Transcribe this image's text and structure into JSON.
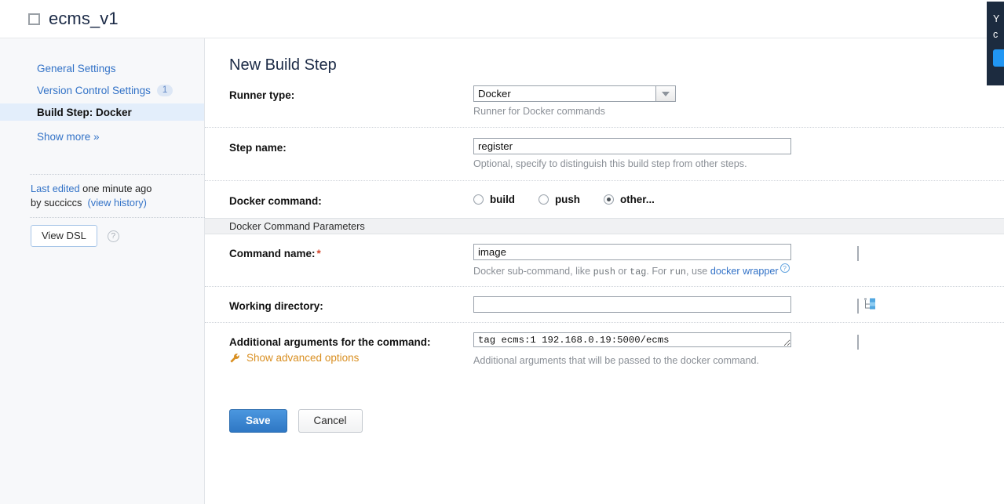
{
  "topbar": {
    "project_title": "ecms_v1",
    "checkbox_icon": "square-outline-icon"
  },
  "sidebar": {
    "items": [
      {
        "label": "General Settings",
        "badge": "",
        "active": false
      },
      {
        "label": "Version Control Settings",
        "badge": "1",
        "active": false
      },
      {
        "label": "Build Step: Docker",
        "badge": "",
        "active": true
      },
      {
        "label": "Show more »",
        "badge": "",
        "active": false
      }
    ],
    "last_edited": {
      "prefix": "Last edited",
      "time": " one minute ago",
      "by": "by succiccs",
      "history_link": "(view history)"
    },
    "view_dsl_button": "View DSL",
    "help_icon": "question-mark-icon"
  },
  "main": {
    "page_title": "New Build Step",
    "runner_type": {
      "label": "Runner type:",
      "value": "Docker",
      "hint": "Runner for Docker commands"
    },
    "step_name": {
      "label": "Step name:",
      "value": "register",
      "hint": "Optional, specify to distinguish this build step from other steps."
    },
    "docker_command": {
      "label": "Docker command:",
      "options": [
        {
          "label": "build",
          "selected": false
        },
        {
          "label": "push",
          "selected": false
        },
        {
          "label": "other...",
          "selected": true
        }
      ]
    },
    "section_header": "Docker Command Parameters",
    "command_name": {
      "label": "Command name:",
      "required_marker": "*",
      "value": "image",
      "hint_part1": "Docker sub-command, like ",
      "hint_code1": "push",
      "hint_part2": " or ",
      "hint_code2": "tag",
      "hint_part3": ". For ",
      "hint_code3": "run",
      "hint_part4": ", use ",
      "hint_link": "docker wrapper",
      "help_icon": "question-mark-icon",
      "edit_icon": "list-edit-icon"
    },
    "working_directory": {
      "label": "Working directory:",
      "value": "",
      "edit_icon": "list-edit-icon",
      "browse_icon": "tree-browse-icon"
    },
    "additional_arguments": {
      "label": "Additional arguments for the command:",
      "value": "tag ecms:1 192.168.0.19:5000/ecms",
      "hint": "Additional arguments that will be passed to the docker command.",
      "edit_icon": "list-edit-icon"
    },
    "advanced_options": {
      "label": "Show advanced options",
      "icon": "wrench-icon"
    },
    "save_button": "Save",
    "cancel_button": "Cancel"
  },
  "notice": {
    "line1": "Y",
    "line2": "c"
  },
  "colors": {
    "accent_blue": "#3272c7",
    "active_nav_bg": "#e3eefb",
    "sidebar_bg": "#f7f8fa",
    "save_button": "#2f77c4",
    "advanced_orange": "#d98f21",
    "required_red": "#d2452c",
    "notice_bg": "#1c2b3f"
  }
}
